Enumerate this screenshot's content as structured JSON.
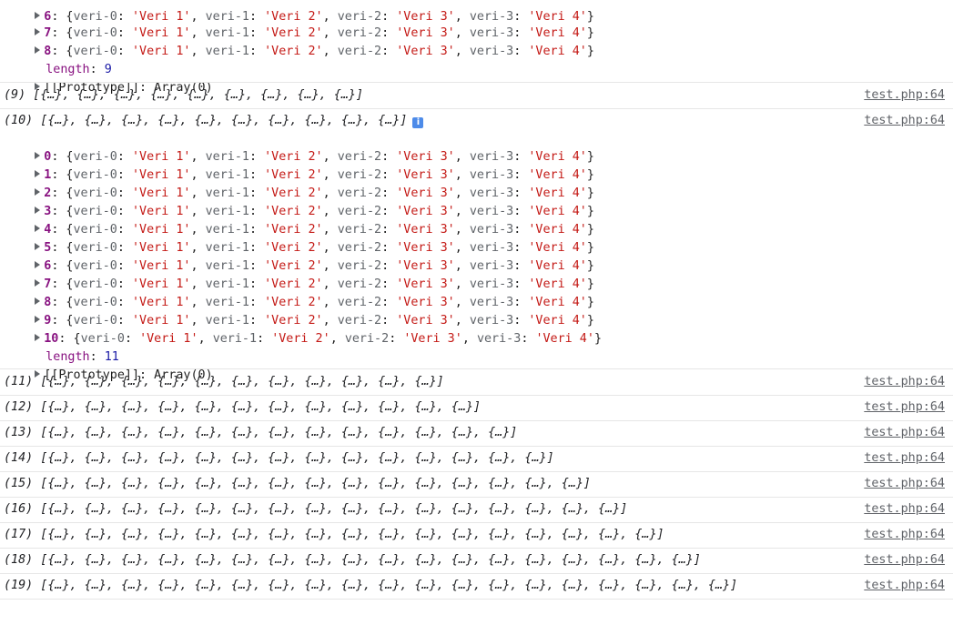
{
  "top_group": {
    "rows": [
      {
        "index": "7",
        "v0": "'Veri 1'",
        "v1": "'Veri 2'",
        "v2": "'Veri 3'",
        "v3": "'Veri 4'"
      },
      {
        "index": "8",
        "v0": "'Veri 1'",
        "v1": "'Veri 2'",
        "v2": "'Veri 3'",
        "v3": "'Veri 4'"
      }
    ],
    "length_label": "length",
    "length_value": "9",
    "prototype": "[[Prototype]]: Array(0)"
  },
  "keys": {
    "k0": "veri-0",
    "k1": "veri-1",
    "k2": "veri-2",
    "k3": "veri-3"
  },
  "messages": [
    {
      "text": "(9) [{…}, {…}, {…}, {…}, {…}, {…}, {…}, {…}, {…}]",
      "source": "test.php:64"
    },
    {
      "text": "(10) [{…}, {…}, {…}, {…}, {…}, {…}, {…}, {…}, {…}, {…}]",
      "source": "test.php:64"
    },
    {
      "text": "(11) [{…}, {…}, {…}, {…}, {…}, {…}, {…}, {…}, {…}, {…}, {…}]",
      "source": "test.php:64"
    },
    {
      "text": "(12) [{…}, {…}, {…}, {…}, {…}, {…}, {…}, {…}, {…}, {…}, {…}, {…}]",
      "source": "test.php:64"
    },
    {
      "text": "(13) [{…}, {…}, {…}, {…}, {…}, {…}, {…}, {…}, {…}, {…}, {…}, {…}, {…}]",
      "source": "test.php:64"
    },
    {
      "text": "(14) [{…}, {…}, {…}, {…}, {…}, {…}, {…}, {…}, {…}, {…}, {…}, {…}, {…}, {…}]",
      "source": "test.php:64"
    },
    {
      "text": "(15) [{…}, {…}, {…}, {…}, {…}, {…}, {…}, {…}, {…}, {…}, {…}, {…}, {…}, {…}, {…}]",
      "source": "test.php:64"
    },
    {
      "text": "(16) [{…}, {…}, {…}, {…}, {…}, {…}, {…}, {…}, {…}, {…}, {…}, {…}, {…}, {…}, {…}, {…}]",
      "source": "test.php:64"
    },
    {
      "text": "(17) [{…}, {…}, {…}, {…}, {…}, {…}, {…}, {…}, {…}, {…}, {…}, {…}, {…}, {…}, {…}, {…}, {…}]",
      "source": "test.php:64"
    },
    {
      "text": "(18) [{…}, {…}, {…}, {…}, {…}, {…}, {…}, {…}, {…}, {…}, {…}, {…}, {…}, {…}, {…}, {…}, {…}, {…}]",
      "source": "test.php:64"
    },
    {
      "text": "(19) [{…}, {…}, {…}, {…}, {…}, {…}, {…}, {…}, {…}, {…}, {…}, {…}, {…}, {…}, {…}, {…}, {…}, {…}, {…}]",
      "source": "test.php:64"
    }
  ],
  "expanded_group": {
    "rows": [
      {
        "index": "0",
        "v0": "'Veri 1'",
        "v1": "'Veri 2'",
        "v2": "'Veri 3'",
        "v3": "'Veri 4'"
      },
      {
        "index": "1",
        "v0": "'Veri 1'",
        "v1": "'Veri 2'",
        "v2": "'Veri 3'",
        "v3": "'Veri 4'"
      },
      {
        "index": "2",
        "v0": "'Veri 1'",
        "v1": "'Veri 2'",
        "v2": "'Veri 3'",
        "v3": "'Veri 4'"
      },
      {
        "index": "3",
        "v0": "'Veri 1'",
        "v1": "'Veri 2'",
        "v2": "'Veri 3'",
        "v3": "'Veri 4'"
      },
      {
        "index": "4",
        "v0": "'Veri 1'",
        "v1": "'Veri 2'",
        "v2": "'Veri 3'",
        "v3": "'Veri 4'"
      },
      {
        "index": "5",
        "v0": "'Veri 1'",
        "v1": "'Veri 2'",
        "v2": "'Veri 3'",
        "v3": "'Veri 4'"
      },
      {
        "index": "6",
        "v0": "'Veri 1'",
        "v1": "'Veri 2'",
        "v2": "'Veri 3'",
        "v3": "'Veri 4'"
      },
      {
        "index": "7",
        "v0": "'Veri 1'",
        "v1": "'Veri 2'",
        "v2": "'Veri 3'",
        "v3": "'Veri 4'"
      },
      {
        "index": "8",
        "v0": "'Veri 1'",
        "v1": "'Veri 2'",
        "v2": "'Veri 3'",
        "v3": "'Veri 4'"
      },
      {
        "index": "9",
        "v0": "'Veri 1'",
        "v1": "'Veri 2'",
        "v2": "'Veri 3'",
        "v3": "'Veri 4'"
      },
      {
        "index": "10",
        "v0": "'Veri 1'",
        "v1": "'Veri 2'",
        "v2": "'Veri 3'",
        "v3": "'Veri 4'"
      }
    ],
    "length_label": "length",
    "length_value": "11",
    "prototype": "[[Prototype]]: Array(0)",
    "info_icon": "i"
  }
}
